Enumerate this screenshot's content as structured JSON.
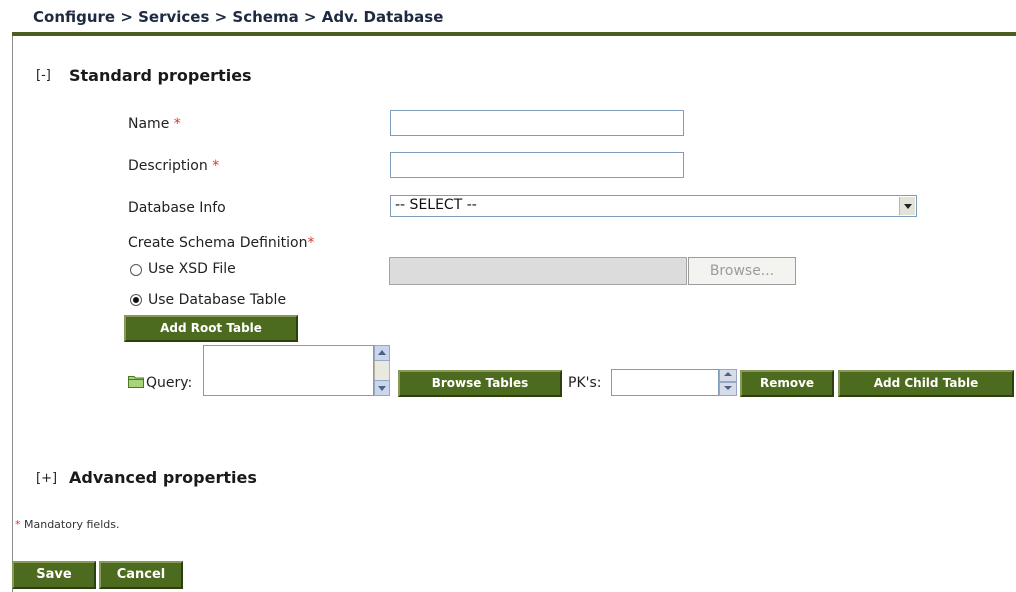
{
  "breadcrumb": "Configure > Services > Schema > Adv. Database",
  "standard": {
    "toggle": "[-]",
    "title": "Standard properties"
  },
  "form": {
    "name_label": "Name",
    "name_value": "",
    "description_label": "Description",
    "description_value": "",
    "required_mark": "*",
    "database_info_label": "Database Info",
    "database_info_selected": "-- SELECT --",
    "create_schema_label": "Create Schema Definition",
    "use_xsd_label": "Use XSD File",
    "use_xsd_selected": false,
    "browse_label": "Browse...",
    "use_db_table_label": "Use Database Table",
    "use_db_table_selected": true,
    "add_root_table_label": "Add Root Table",
    "query_label": "Query:",
    "query_value": "",
    "browse_tables_label": "Browse Tables",
    "pks_label": "PK's:",
    "pks_value": "",
    "remove_label": "Remove",
    "add_child_table_label": "Add Child Table"
  },
  "advanced": {
    "toggle": "[+]",
    "title": "Advanced properties"
  },
  "footnote": {
    "mark": "*",
    "text": " Mandatory fields."
  },
  "actions": {
    "save_label": "Save",
    "cancel_label": "Cancel"
  },
  "icons": {
    "query_icon": "folder-icon",
    "scroll_up": "arrow-up-icon",
    "scroll_down": "arrow-down-icon",
    "select_arrow": "chevron-down-icon"
  },
  "colors": {
    "button_green": "#4d6b1e",
    "header_rule": "#4b5e1f",
    "required": "#dd3333",
    "breadcrumb_text": "#1d2a40"
  }
}
